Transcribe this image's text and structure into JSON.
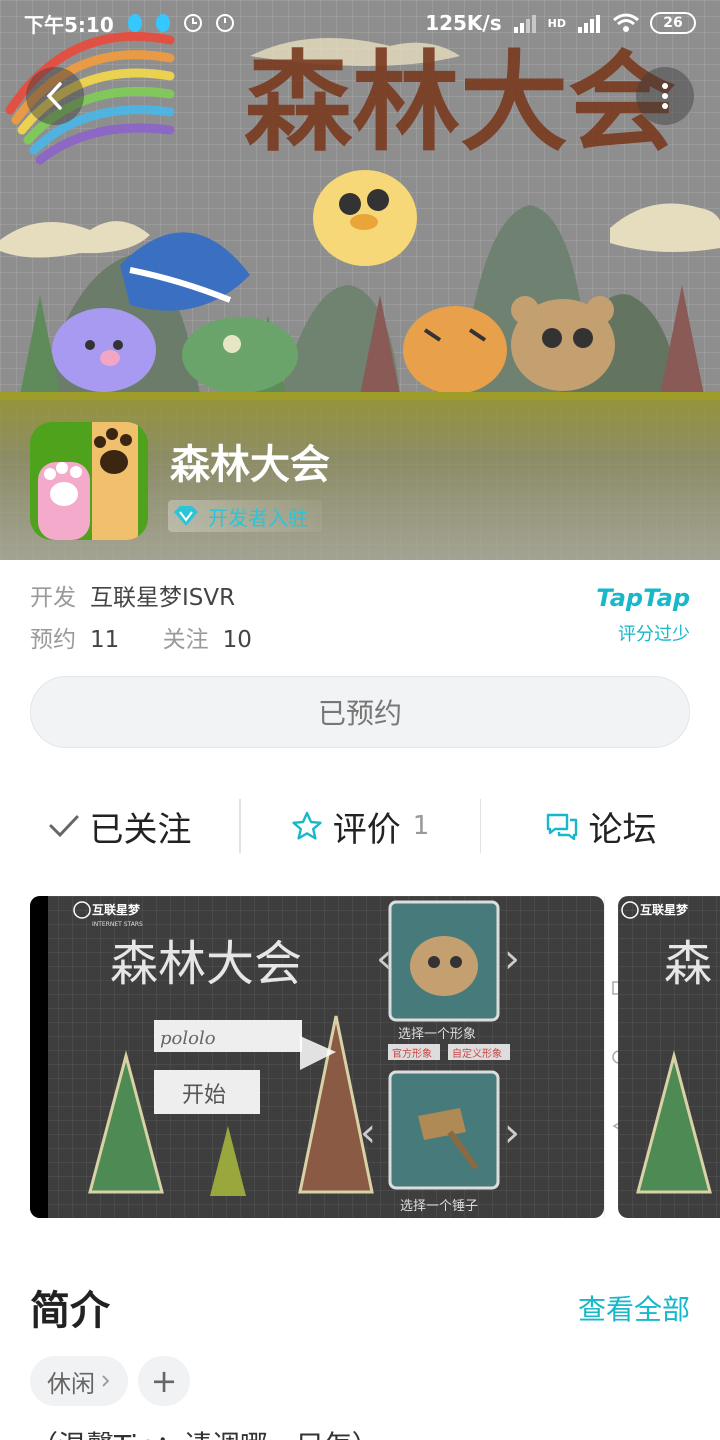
{
  "status_bar": {
    "time": "下午5:10",
    "network_speed": "125K/s",
    "signal_label": "HD",
    "battery": "26"
  },
  "banner": {
    "title_art": "森林大会"
  },
  "app": {
    "title": "森林大会",
    "developer_badge": "开发者入驻"
  },
  "info": {
    "developer_label": "开发",
    "developer_value": "互联星梦ISVR",
    "reservations_label": "预约",
    "reservations_value": "11",
    "followers_label": "关注",
    "followers_value": "10",
    "taptap_logo": "TapTap",
    "taptap_score": "评分过少"
  },
  "reserve_button": "已预约",
  "actions": {
    "follow": "已关注",
    "review": "评价",
    "review_count": "1",
    "forum": "论坛"
  },
  "screenshot": {
    "brand": "互联星梦",
    "brand_sub": "INTERNET STARS",
    "game_title": "森林大会",
    "name_input": "pololo",
    "start_button": "开始",
    "choose_avatar": "选择一个形象",
    "official_avatar": "官方形象",
    "custom_avatar": "自定义形象",
    "choose_hammer": "选择一个锤子"
  },
  "intro": {
    "title": "简介",
    "see_all": "查看全部",
    "tag_casual": "休闲",
    "tag_add": "+",
    "description": "（温馨Tip：请调哪一只怎）"
  },
  "colors": {
    "accent": "#16b8c9",
    "grass": "#c4b91a"
  }
}
